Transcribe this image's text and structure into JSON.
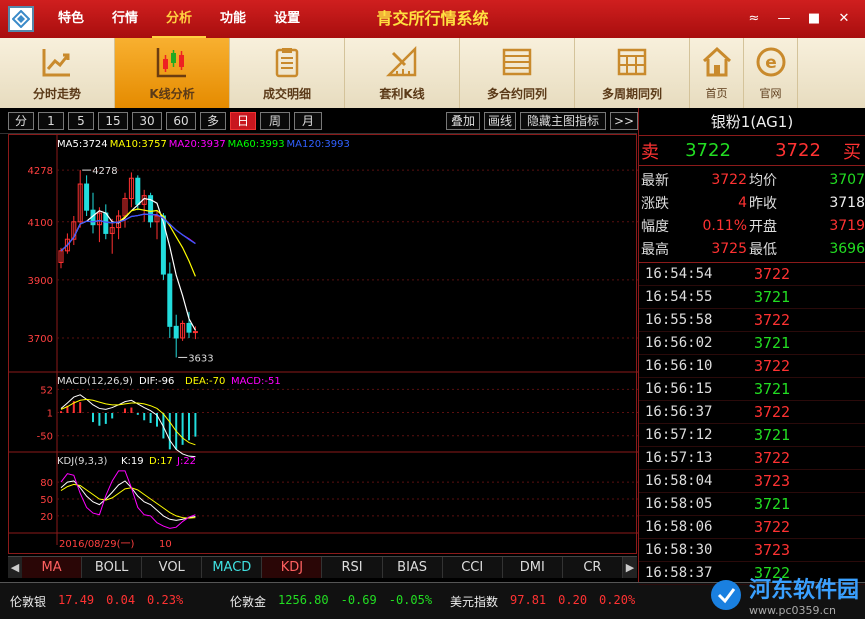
{
  "menu": [
    "特色",
    "行情",
    "分析",
    "功能",
    "设置"
  ],
  "menu_active": 2,
  "app_title": "青交所行情系统",
  "window_controls": [
    "≈",
    "—",
    "■",
    "✕"
  ],
  "toolbar": [
    {
      "label": "分时走势",
      "icon": "trend-chart-icon"
    },
    {
      "label": "K线分析",
      "icon": "candlestick-icon",
      "active": true
    },
    {
      "label": "成交明细",
      "icon": "clipboard-icon"
    },
    {
      "label": "套利K线",
      "icon": "ruler-icon"
    },
    {
      "label": "多合约同列",
      "icon": "list-icon"
    },
    {
      "label": "多周期同列",
      "icon": "grid-icon"
    }
  ],
  "toolbar_small": [
    {
      "label": "首页",
      "icon": "home-icon"
    },
    {
      "label": "官网",
      "icon": "ie-icon"
    }
  ],
  "periods": [
    "分",
    "1",
    "5",
    "15",
    "30",
    "60",
    "多",
    "日",
    "周",
    "月"
  ],
  "period_active": "日",
  "chart_actions": [
    "叠加",
    "画线",
    "隐藏主图指标",
    ">>"
  ],
  "main_legend": [
    {
      "text": "MA5:3724",
      "color": "#ffffff"
    },
    {
      "text": "MA10:3757",
      "color": "#ffff00"
    },
    {
      "text": "MA20:3937",
      "color": "#ff00ff"
    },
    {
      "text": "MA60:3993",
      "color": "#00ff00"
    },
    {
      "text": "MA120:3993",
      "color": "#3060ff"
    }
  ],
  "macd_legend": [
    {
      "text": "MACD(12,26,9)",
      "color": "#dddddd"
    },
    {
      "text": "DIF:-96",
      "color": "#ffffff"
    },
    {
      "text": "DEA:-70",
      "color": "#ffff00"
    },
    {
      "text": "MACD:-51",
      "color": "#ff00ff"
    }
  ],
  "kdj_legend": [
    {
      "text": "KDJ(9,3,3)",
      "color": "#dddddd"
    },
    {
      "text": "K:19",
      "color": "#ffffff"
    },
    {
      "text": "D:17",
      "color": "#ffff00"
    },
    {
      "text": "J:22",
      "color": "#ff00ff"
    }
  ],
  "x_labels": [
    "2016/08/29(一)",
    "10"
  ],
  "indicators": [
    "MA",
    "BOLL",
    "VOL",
    "MACD",
    "KDJ",
    "RSI",
    "BIAS",
    "CCI",
    "DMI",
    "CR"
  ],
  "indicator_colors": {
    "MA": "#ff6060",
    "MACD": "#40e0e0",
    "KDJ": "#ff6060"
  },
  "ticker": [
    {
      "name": "伦敦银",
      "price": "17.49",
      "chg": "0.04",
      "pct": "0.23%",
      "color": "red"
    },
    {
      "name": "伦敦金",
      "price": "1256.80",
      "chg": "-0.69",
      "pct": "-0.05%",
      "color": "green"
    },
    {
      "name": "美元指数",
      "price": "97.81",
      "chg": "0.20",
      "pct": "0.20%",
      "color": "red"
    }
  ],
  "instrument": "银粉1(AG1)",
  "quote": {
    "sell_label": "卖",
    "sell_price": "3722",
    "buy_price": "3722",
    "buy_label": "买"
  },
  "stats": [
    {
      "l1": "最新",
      "v1": "3722",
      "c1": "red",
      "l2": "均价",
      "v2": "3707",
      "c2": "green"
    },
    {
      "l1": "涨跌",
      "v1": "4",
      "c1": "red",
      "l2": "昨收",
      "v2": "3718",
      "c2": "white"
    },
    {
      "l1": "幅度",
      "v1": "0.11%",
      "c1": "red",
      "l2": "开盘",
      "v2": "3719",
      "c2": "red"
    },
    {
      "l1": "最高",
      "v1": "3725",
      "c1": "red",
      "l2": "最低",
      "v2": "3696",
      "c2": "green"
    }
  ],
  "ticks": [
    {
      "time": "16:54:54",
      "price": "3722",
      "color": "red"
    },
    {
      "time": "16:54:55",
      "price": "3721",
      "color": "green"
    },
    {
      "time": "16:55:58",
      "price": "3722",
      "color": "red"
    },
    {
      "time": "16:56:02",
      "price": "3721",
      "color": "green"
    },
    {
      "time": "16:56:10",
      "price": "3722",
      "color": "red"
    },
    {
      "time": "16:56:15",
      "price": "3721",
      "color": "green"
    },
    {
      "time": "16:56:37",
      "price": "3722",
      "color": "red"
    },
    {
      "time": "16:57:12",
      "price": "3721",
      "color": "green"
    },
    {
      "time": "16:57:13",
      "price": "3722",
      "color": "red"
    },
    {
      "time": "16:58:04",
      "price": "3723",
      "color": "red"
    },
    {
      "time": "16:58:05",
      "price": "3721",
      "color": "green"
    },
    {
      "time": "16:58:06",
      "price": "3722",
      "color": "red"
    },
    {
      "time": "16:58:30",
      "price": "3723",
      "color": "red"
    },
    {
      "time": "16:58:37",
      "price": "3722",
      "color": "green"
    }
  ],
  "watermark": {
    "name": "河东软件园",
    "url": "www.pc0359.cn"
  },
  "chart_data": {
    "type": "candlestick",
    "main_yticks": [
      "4278",
      "4100",
      "3900",
      "3700"
    ],
    "main_ylim": [
      3600,
      4330
    ],
    "annotations": [
      {
        "text": "4278"
      },
      {
        "text": "3633"
      }
    ],
    "macd_yticks": [
      "52",
      "1",
      "-50"
    ],
    "kdj_yticks": [
      "80",
      "50",
      "20"
    ],
    "ohlc": [
      [
        3960,
        4010,
        3940,
        4000
      ],
      [
        4000,
        4060,
        3990,
        4040
      ],
      [
        4040,
        4120,
        4020,
        4100
      ],
      [
        4100,
        4278,
        4080,
        4230
      ],
      [
        4230,
        4260,
        4120,
        4140
      ],
      [
        4140,
        4200,
        4060,
        4090
      ],
      [
        4090,
        4150,
        4030,
        4130
      ],
      [
        4130,
        4160,
        4040,
        4060
      ],
      [
        4060,
        4110,
        3990,
        4080
      ],
      [
        4080,
        4140,
        4040,
        4120
      ],
      [
        4120,
        4200,
        4080,
        4180
      ],
      [
        4180,
        4270,
        4150,
        4250
      ],
      [
        4250,
        4260,
        4140,
        4160
      ],
      [
        4160,
        4210,
        4100,
        4190
      ],
      [
        4190,
        4200,
        4080,
        4100
      ],
      [
        4100,
        4140,
        4040,
        4120
      ],
      [
        4120,
        4130,
        3900,
        3920
      ],
      [
        3920,
        3960,
        3700,
        3740
      ],
      [
        3740,
        3780,
        3633,
        3700
      ],
      [
        3700,
        3760,
        3690,
        3750
      ],
      [
        3750,
        3790,
        3700,
        3720
      ],
      [
        3720,
        3740,
        3696,
        3722
      ]
    ],
    "macd": [
      10,
      22,
      35,
      40,
      30,
      18,
      10,
      8,
      12,
      18,
      25,
      28,
      20,
      12,
      5,
      -5,
      -30,
      -60,
      -80,
      -90,
      -95,
      -96
    ],
    "dea": [
      8,
      14,
      22,
      28,
      30,
      28,
      24,
      20,
      18,
      18,
      20,
      22,
      22,
      20,
      16,
      10,
      -2,
      -20,
      -40,
      -55,
      -65,
      -70
    ],
    "kdj_k": [
      70,
      80,
      82,
      70,
      55,
      45,
      40,
      50,
      62,
      75,
      82,
      70,
      55,
      45,
      40,
      30,
      20,
      14,
      12,
      14,
      17,
      19
    ],
    "kdj_d": [
      65,
      72,
      76,
      74,
      66,
      58,
      50,
      48,
      52,
      60,
      68,
      70,
      66,
      58,
      50,
      42,
      34,
      26,
      20,
      17,
      16,
      17
    ],
    "kdj_j": [
      80,
      95,
      92,
      60,
      35,
      25,
      22,
      56,
      82,
      100,
      100,
      70,
      35,
      22,
      20,
      8,
      2,
      -2,
      0,
      10,
      18,
      22
    ]
  }
}
